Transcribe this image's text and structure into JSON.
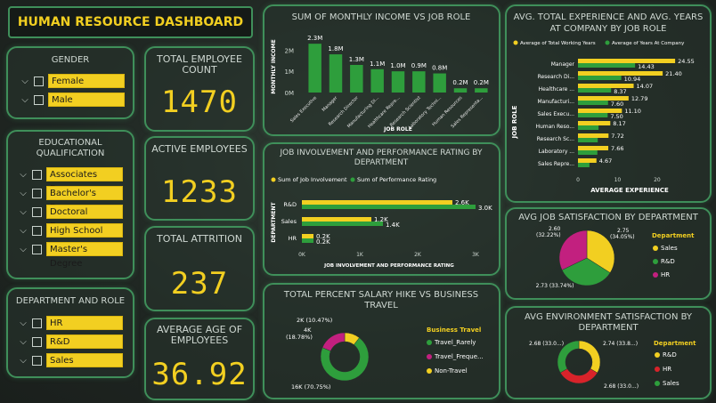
{
  "dashboard_title": "HUMAN RESOURCE DASHBOARD",
  "colors": {
    "yellow": "#f2cf21",
    "green": "#2e9e3c",
    "magenta": "#c2207f",
    "red": "#d8232a",
    "border": "#3f8f5a"
  },
  "slicers": {
    "gender": {
      "title": "GENDER",
      "items": [
        "Female",
        "Male"
      ]
    },
    "education": {
      "title": "EDUCATIONAL QUALIFICATION",
      "items": [
        "Associates Degree",
        "Bachelor's Degree",
        "Doctoral Degree",
        "High School",
        "Master's Degree"
      ]
    },
    "department": {
      "title": "DEPARTMENT AND ROLE",
      "items": [
        "HR",
        "R&D",
        "Sales"
      ]
    }
  },
  "kpis": {
    "total_employee": {
      "title": "TOTAL EMPLOYEE COUNT",
      "value": "1470"
    },
    "active": {
      "title": "ACTIVE EMPLOYEES",
      "value": "1233"
    },
    "attrition": {
      "title": "TOTAL ATTRITION",
      "value": "237"
    },
    "avg_age": {
      "title": "AVERAGE AGE OF EMPLOYEES",
      "value": "36.92"
    }
  },
  "chart_data": [
    {
      "id": "income",
      "type": "bar",
      "title": "SUM OF MONTHLY INCOME VS JOB ROLE",
      "xlabel": "JOB ROLE",
      "ylabel": "MONTHLY INCOME",
      "yticks": [
        "2M",
        "1M",
        "0M"
      ],
      "categories": [
        "Sales Executive",
        "Manager",
        "Research Director",
        "Manufacturing Di...",
        "Healthcare Repre...",
        "Research Scientist",
        "Laboratory Techni...",
        "Human Resources",
        "Sales Representa..."
      ],
      "values": [
        2.3,
        1.8,
        1.3,
        1.1,
        1.0,
        1.0,
        0.9,
        0.2,
        0.2
      ],
      "labels": [
        "2.3M",
        "1.8M",
        "1.3M",
        "1.1M",
        "1.0M",
        "0.9M",
        "0.8M",
        "0.2M",
        "0.2M"
      ],
      "ylim": [
        0,
        2.6
      ]
    },
    {
      "id": "experience",
      "type": "bar",
      "title": "AVG. TOTAL EXPERIENCE AND AVG. YEARS AT COMPANY BY JOB ROLE",
      "xlabel": "AVERAGE EXPERIENCE",
      "ylabel": "JOB ROLE",
      "legend": [
        "Average of Total Working Years",
        "Average of Years At Company"
      ],
      "categories": [
        "Manager",
        "Research Di...",
        "Healthcare ...",
        "Manufacturi...",
        "Sales Execu...",
        "Human Reso...",
        "Research Sc...",
        "Laboratory ...",
        "Sales Repre..."
      ],
      "series": [
        {
          "name": "Average of Total Working Years",
          "values": [
            24.55,
            21.4,
            14.07,
            12.79,
            11.1,
            8.17,
            7.72,
            7.66,
            4.67
          ]
        },
        {
          "name": "Average of Years At Company",
          "values": [
            14.43,
            10.94,
            8.37,
            7.6,
            7.5,
            5.2,
            5.0,
            4.9,
            2.9
          ]
        }
      ],
      "labels": [
        [
          "24.55",
          "14.43"
        ],
        [
          "21.40",
          "10.94"
        ],
        [
          "14.07",
          "8.37"
        ],
        [
          "12.79",
          "7.60"
        ],
        [
          "11.10",
          "7.50"
        ],
        [
          "8.17",
          ""
        ],
        [
          "7.72",
          ""
        ],
        [
          "7.66",
          ""
        ],
        [
          "4.67",
          ""
        ]
      ],
      "xticks": [
        "0",
        "10",
        "20"
      ],
      "xlim": [
        0,
        27
      ]
    },
    {
      "id": "involvement",
      "type": "bar",
      "title": "JOB INVOLVEMENT AND PERFORMANCE RATING BY DEPARTMENT",
      "xlabel": "JOB INVOLVEMENT AND PERFORMANCE RATING",
      "ylabel": "DEPARTMENT",
      "legend": [
        "Sum of Job Involvement",
        "Sum of Performance Rating"
      ],
      "categories": [
        "R&D",
        "Sales",
        "HR"
      ],
      "series": [
        {
          "name": "Sum of Job Involvement",
          "values": [
            2600,
            1200,
            200
          ]
        },
        {
          "name": "Sum of Performance Rating",
          "values": [
            3000,
            1400,
            200
          ]
        }
      ],
      "labels": [
        [
          "2.6K",
          "3.0K"
        ],
        [
          "1.2K",
          "1.4K"
        ],
        [
          "0.2K",
          "0.2K"
        ]
      ],
      "xticks": [
        "0K",
        "1K",
        "2K",
        "3K"
      ],
      "xlim": [
        0,
        3000
      ]
    },
    {
      "id": "satisfaction",
      "type": "pie",
      "title": "AVG JOB SATISFACTION BY DEPARTMENT",
      "legend_title": "Department",
      "slices": [
        {
          "name": "Sales",
          "value": 2.75,
          "label": "2.75 (34.05%)"
        },
        {
          "name": "R&D",
          "value": 2.73,
          "label": "2.73 (33.74%)"
        },
        {
          "name": "HR",
          "value": 2.6,
          "label": "2.60 (32.22%)"
        }
      ]
    },
    {
      "id": "salary",
      "type": "pie",
      "title": "TOTAL PERCENT SALARY HIKE VS BUSINESS TRAVEL",
      "legend_title": "Business Travel",
      "slices": [
        {
          "name": "Travel_Rarely",
          "value": 70.75,
          "label": "16K (70.75%)"
        },
        {
          "name": "Travel_Freque...",
          "value": 18.78,
          "label": "4K (18.78%)"
        },
        {
          "name": "Non-Travel",
          "value": 10.47,
          "label": "2K (10.47%)"
        }
      ]
    },
    {
      "id": "environment",
      "type": "pie",
      "title": "AVG ENVIRONMENT SATISFACTION BY DEPARTMENT",
      "legend_title": "Department",
      "slices": [
        {
          "name": "R&D",
          "value": 33.4,
          "label": "2.74 (33.8...)"
        },
        {
          "name": "HR",
          "value": 33.3,
          "label": "2.68 (33.0...)"
        },
        {
          "name": "Sales",
          "value": 33.3,
          "label": "2.68 (33.0...)"
        }
      ]
    }
  ]
}
